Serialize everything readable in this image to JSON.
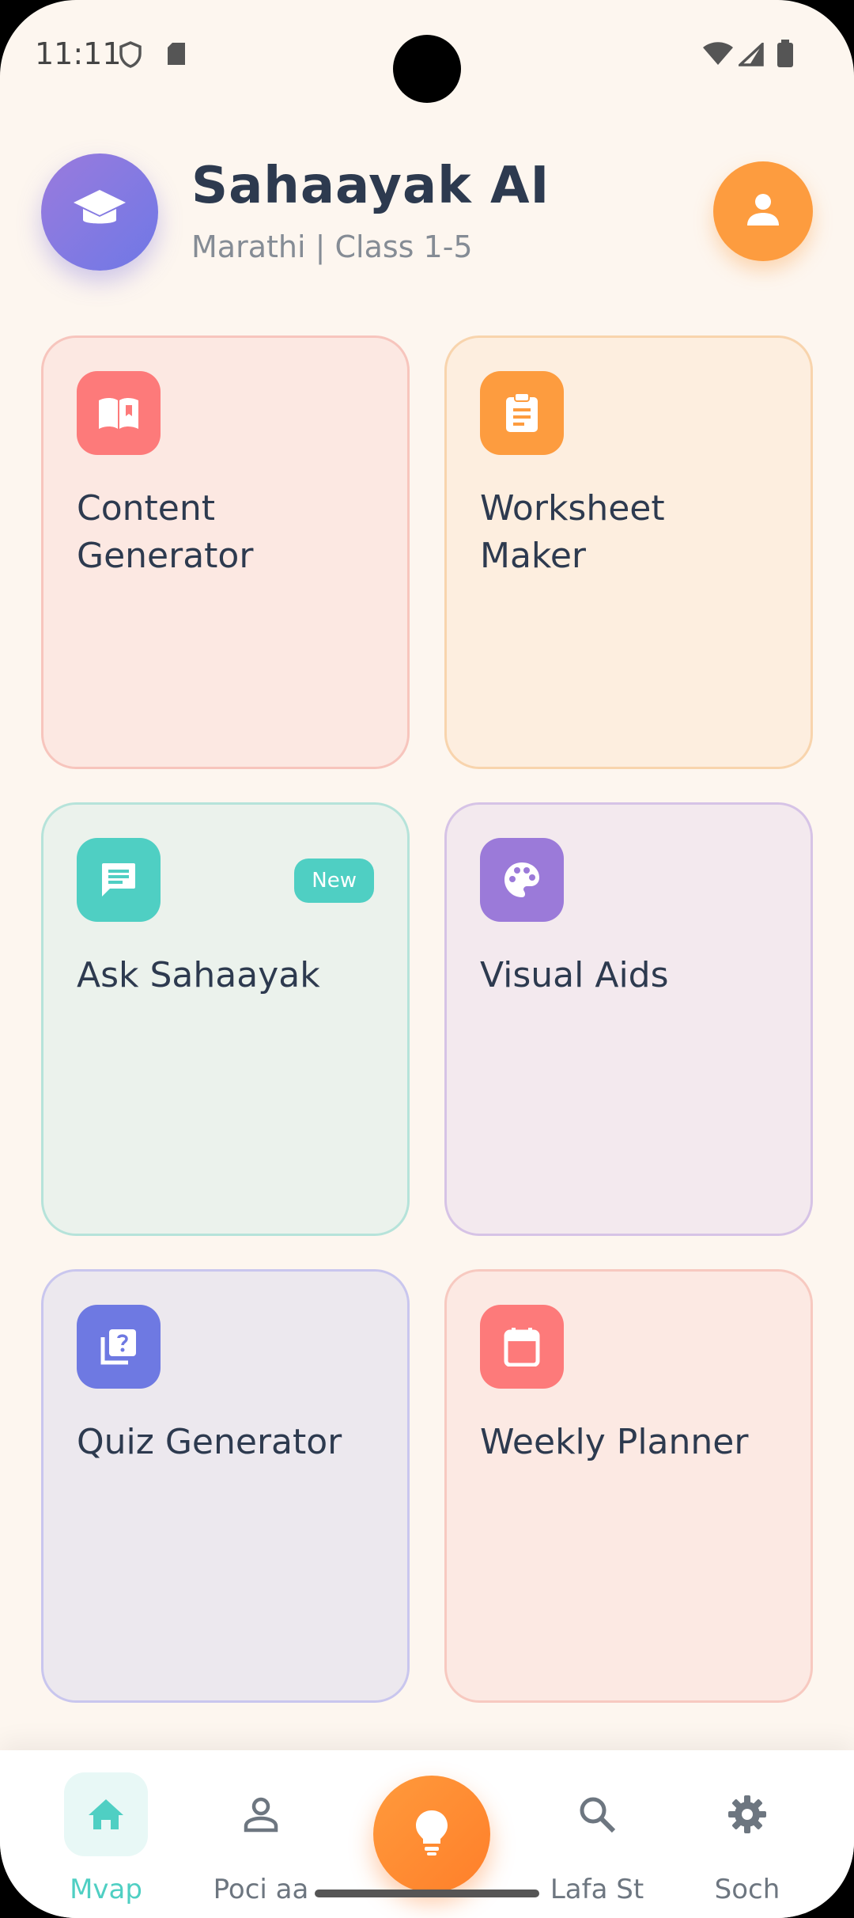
{
  "status_bar": {
    "time": "11:11",
    "icons": [
      "shield-icon",
      "sd-card-icon",
      "wifi-icon",
      "signal-icon",
      "battery-icon"
    ]
  },
  "header": {
    "title": "Sahaayak AI",
    "subtitle": "Marathi | Class 1-5",
    "logo_icon": "graduation-cap-icon",
    "profile_icon": "user-icon"
  },
  "cards": [
    {
      "label": "Content Generator",
      "icon": "book-icon",
      "color": "#fd7a7a",
      "bg": "#fce8e2",
      "border": "#f7c5bd"
    },
    {
      "label": "Worksheet Maker",
      "icon": "clipboard-icon",
      "color": "#fd9c3f",
      "bg": "#fdeedf",
      "border": "#f8d4ad"
    },
    {
      "label": "Ask Sahaayak",
      "icon": "chat-icon",
      "color": "#4fcfc3",
      "bg": "#ebf2ec",
      "border": "#b6e3da",
      "badge": "New"
    },
    {
      "label": "Visual Aids",
      "icon": "palette-icon",
      "color": "#9b7ad9",
      "bg": "#f3e9ee",
      "border": "#d6c3e6"
    },
    {
      "label": "Quiz Generator",
      "icon": "quiz-icon",
      "color": "#6e79e2",
      "bg": "#ece8ee",
      "border": "#c9c6ee"
    },
    {
      "label": "Weekly Planner",
      "icon": "calendar-icon",
      "color": "#fd7a7a",
      "bg": "#fce9e3",
      "border": "#f7c9c0"
    }
  ],
  "nav": {
    "items": [
      {
        "label": "Mvap",
        "icon": "home-icon",
        "active": true
      },
      {
        "label": "Poci aa",
        "icon": "person-icon",
        "active": false
      },
      {
        "label": "Lafa St",
        "icon": "search-icon",
        "active": false
      },
      {
        "label": "Soch",
        "icon": "gear-icon",
        "active": false
      }
    ],
    "fab_icon": "lightbulb-icon"
  },
  "colors": {
    "accent": "#4fcfc3",
    "orange": "#fd9c3f",
    "title": "#2d3a4f",
    "background": "#fdf6ef"
  }
}
